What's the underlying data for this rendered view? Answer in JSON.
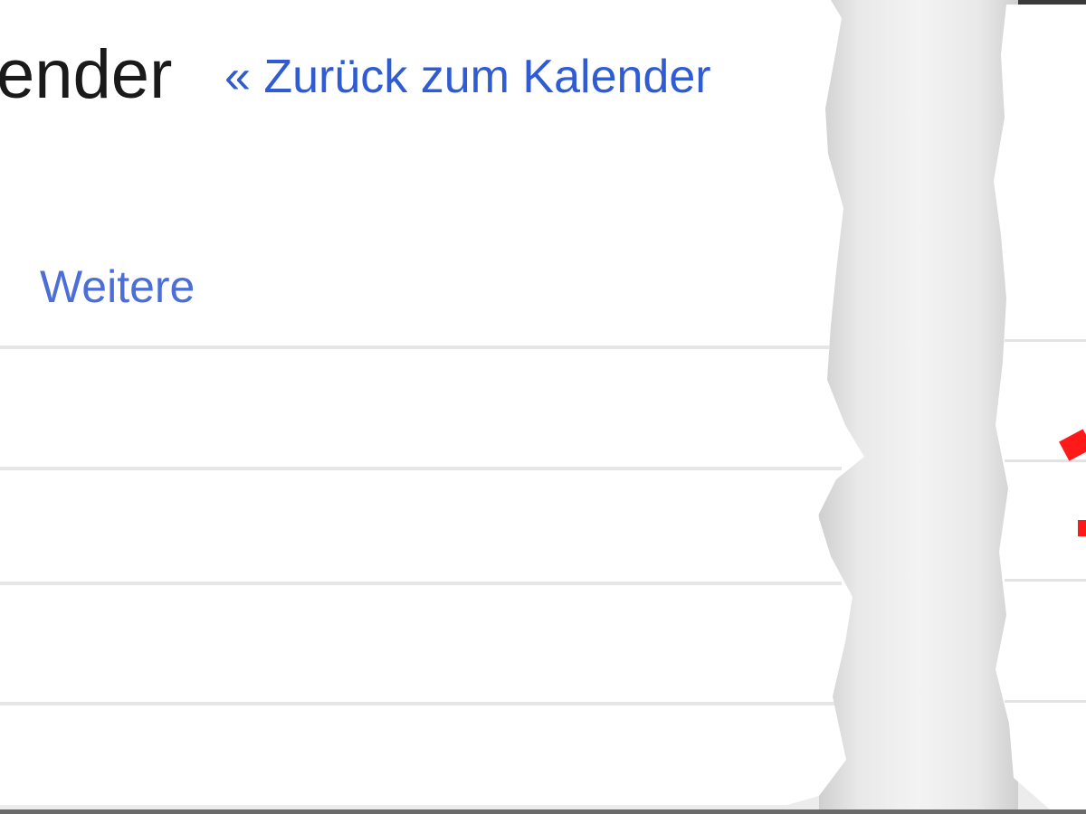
{
  "header": {
    "title_fragment": "ender",
    "back_link": "« Zurück zum Kalender"
  },
  "nav": {
    "more_link": "Weitere"
  },
  "colors": {
    "link": "#2f5bd3",
    "accent_mark": "#ff1a1a"
  }
}
